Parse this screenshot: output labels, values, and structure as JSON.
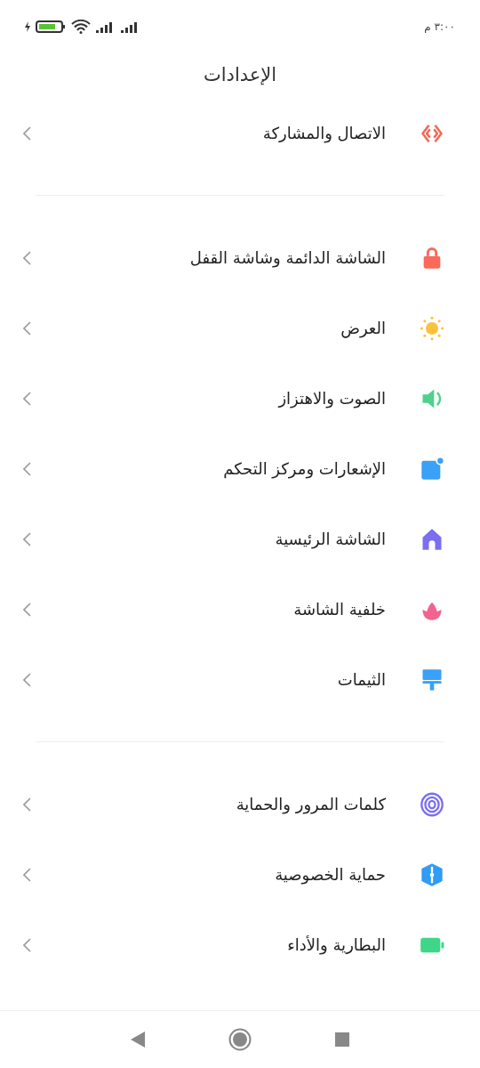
{
  "status_bar": {
    "time": "٣:٠٠ م"
  },
  "title": "الإعدادات",
  "groups": [
    [
      {
        "label": "الاتصال والمشاركة",
        "kind": "share"
      }
    ],
    [
      {
        "label": "الشاشة الدائمة وشاشة القفل",
        "kind": "lock"
      },
      {
        "label": "العرض",
        "kind": "sun"
      },
      {
        "label": "الصوت والاهتزاز",
        "kind": "sound"
      },
      {
        "label": "الإشعارات ومركز التحكم",
        "kind": "notification"
      },
      {
        "label": "الشاشة الرئيسية",
        "kind": "home"
      },
      {
        "label": "خلفية الشاشة",
        "kind": "flower"
      },
      {
        "label": "الثيمات",
        "kind": "brush"
      }
    ],
    [
      {
        "label": "كلمات المرور والحماية",
        "kind": "fingerprint"
      },
      {
        "label": "حماية الخصوصية",
        "kind": "privacy"
      },
      {
        "label": "البطارية والأداء",
        "kind": "battery"
      }
    ]
  ]
}
